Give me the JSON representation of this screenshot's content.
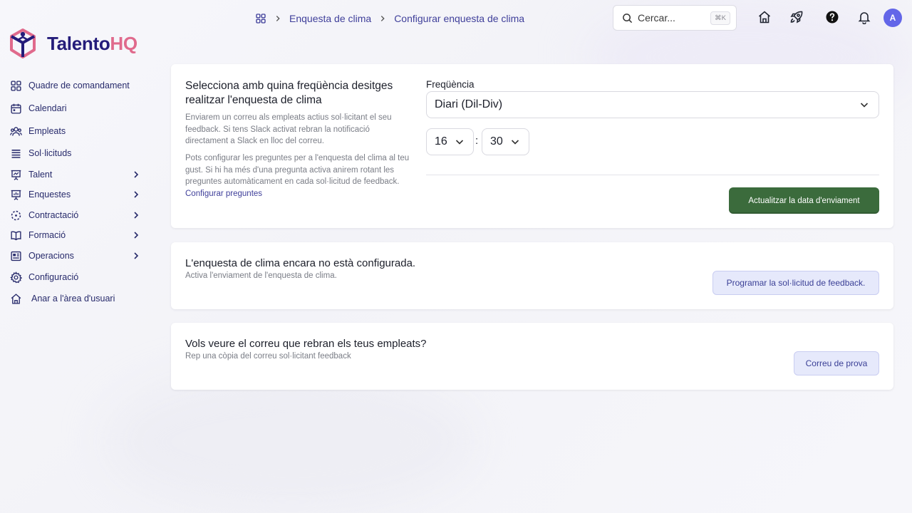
{
  "brand": {
    "name_part1": "Talento",
    "name_part2": "HQ"
  },
  "sidebar": {
    "items": [
      {
        "label": "Quadre de comandament",
        "icon": "grid-icon",
        "expandable": false
      },
      {
        "label": "Calendari",
        "icon": "calendar-icon",
        "expandable": false
      },
      {
        "label": "Empleats",
        "icon": "users-icon",
        "expandable": false
      },
      {
        "label": "Sol·licituds",
        "icon": "list-icon",
        "expandable": false
      },
      {
        "label": "Talent",
        "icon": "presentation-icon",
        "expandable": true
      },
      {
        "label": "Enquestes",
        "icon": "chart-board-icon",
        "expandable": true
      },
      {
        "label": "Contractació",
        "icon": "dashed-circle-icon",
        "expandable": true
      },
      {
        "label": "Formació",
        "icon": "book-icon",
        "expandable": true
      },
      {
        "label": "Operacions",
        "icon": "newspaper-icon",
        "expandable": true
      },
      {
        "label": "Configuració",
        "icon": "gear-icon",
        "expandable": false
      },
      {
        "label": "Anar a l'àrea d'usuari",
        "icon": "home-icon",
        "expandable": false
      }
    ]
  },
  "breadcrumb": {
    "items": [
      "Enquesta de clima",
      "Configurar enquesta de clima"
    ]
  },
  "search": {
    "placeholder": "Cercar...",
    "shortcut": "⌘K"
  },
  "user": {
    "avatar_initial": "A"
  },
  "frequency_card": {
    "title": "Selecciona amb quina freqüència desitges realitzar l'enquesta de clima",
    "description1": "Enviarem un correu als empleats actius sol·licitant el seu feedback. Si tens Slack activat rebran la notificació directament a Slack en lloc del correu.",
    "description2": "Pots configurar les preguntes per a l'enquesta del clima al teu gust. Si hi ha més d'una pregunta activa anirem rotant les preguntes automàticament en cada sol·licitud de feedback.",
    "configure_link": "Configurar preguntes",
    "frequency_label": "Freqüència",
    "frequency_value": "Diari (Dil-Div)",
    "hour_value": "16",
    "minute_value": "30",
    "time_separator": ":",
    "update_button": "Actualitzar la data d'enviament"
  },
  "status_card": {
    "title": "L'enquesta de clima encara no està configurada.",
    "subtitle": "Activa l'enviament de l'enquesta de clima.",
    "button": "Programar la sol·licitud de feedback."
  },
  "email_card": {
    "title": "Vols veure el correu que rebran els teus empleats?",
    "subtitle": "Rep una còpia del correu sol·licitant feedback",
    "button": "Correu de prova"
  },
  "colors": {
    "primary_button": "#3b6b3c",
    "nav_text": "#272a6b",
    "link": "#3f3f9a",
    "avatar": "#6366e8",
    "brand_dark": "#241c7a",
    "brand_accent": "#e06a8c"
  }
}
